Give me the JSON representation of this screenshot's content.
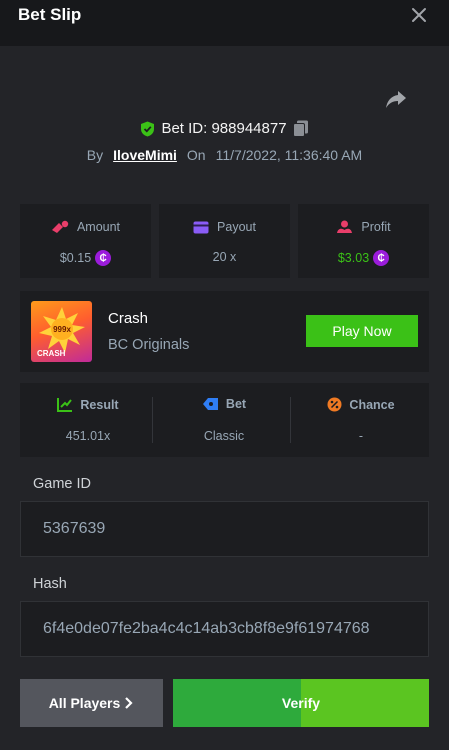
{
  "header": {
    "title": "Bet Slip",
    "close_icon": "close-icon"
  },
  "bet": {
    "id_label": "Bet ID: 988944877",
    "by_label": "By",
    "user": "IloveMimi",
    "on_label": "On",
    "datetime": "11/7/2022, 11:36:40 AM"
  },
  "stats": {
    "amount_label": "Amount",
    "amount_value": "$0.15",
    "payout_label": "Payout",
    "payout_value": "20 x",
    "profit_label": "Profit",
    "profit_value": "$3.03"
  },
  "game": {
    "name": "Crash",
    "provider": "BC Originals",
    "play_label": "Play Now",
    "thumb_badge": "999x",
    "thumb_text": "CRASH"
  },
  "results": {
    "result_label": "Result",
    "result_value": "451.01x",
    "bet_label": "Bet",
    "bet_value": "Classic",
    "chance_label": "Chance",
    "chance_value": "-"
  },
  "fields": {
    "game_id_label": "Game ID",
    "game_id_value": "5367639",
    "hash_label": "Hash",
    "hash_value": "6f4e0de07fe2ba4c4c14ab3cb8f8e9f61974768"
  },
  "actions": {
    "all_players_label": "All Players",
    "verify_label": "Verify"
  },
  "colors": {
    "accent_green": "#3bc117",
    "coin_purple": "#9b1cdb",
    "background": "#232428",
    "panel": "#1c1d20"
  }
}
